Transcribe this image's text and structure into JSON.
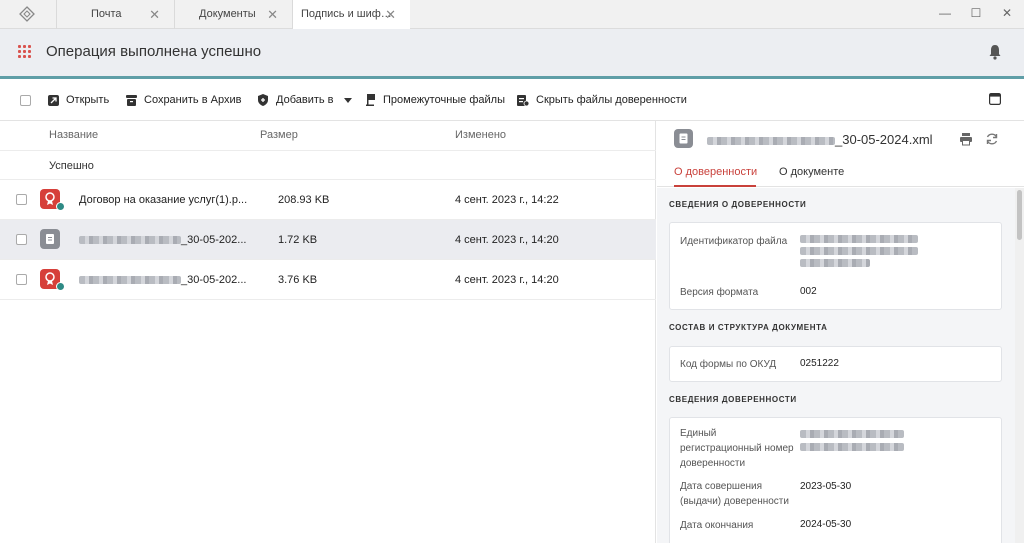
{
  "tabs": [
    {
      "label": "Почта"
    },
    {
      "label": "Документы"
    },
    {
      "label": "Подпись и шиф…",
      "active": true
    }
  ],
  "header": {
    "title": "Операция выполнена успешно"
  },
  "toolbar": {
    "open": "Открыть",
    "save_archive": "Сохранить в Архив",
    "add_to": "Добавить в",
    "intermediate": "Промежуточные файлы",
    "hide_poa": "Скрыть файлы доверенности"
  },
  "list": {
    "columns": {
      "name": "Название",
      "size": "Размер",
      "modified": "Изменено"
    },
    "group": "Успешно",
    "rows": [
      {
        "name": "Договор на оказание услуг(1).p...",
        "size": "208.93 KB",
        "date": "4 сент. 2023 г., 14:22",
        "icon": "certificate-icon",
        "color": "#d6403a"
      },
      {
        "name_suffix": "_30-05-202...",
        "size": "1.72 KB",
        "date": "4 сент. 2023 г., 14:20",
        "icon": "document-icon",
        "color": "#8a8d94"
      },
      {
        "name_suffix": "_30-05-202...",
        "size": "3.76 KB",
        "date": "4 сент. 2023 г., 14:20",
        "icon": "certificate-icon",
        "color": "#d6403a"
      }
    ]
  },
  "panel": {
    "file_suffix": "_30-05-2024.xml",
    "tabs": {
      "poa": "О доверенности",
      "doc": "О документе"
    },
    "sections": {
      "s1": "СВЕДЕНИЯ О ДОВЕРЕННОСТИ",
      "s2": "СОСТАВ И СТРУКТУРА ДОКУМЕНТА",
      "s3": "СВЕДЕНИЯ ДОВЕРЕННОСТИ"
    },
    "fields": {
      "file_id_label": "Идентификатор файла",
      "format_version_label": "Версия формата",
      "format_version": "002",
      "okud_label": "Код формы по ОКУД",
      "okud": "0251222",
      "reg_number_label": "Единый регистрационный номер доверенности",
      "issue_date_label": "Дата совершения (выдачи) доверенности",
      "issue_date": "2023-05-30",
      "end_date_label": "Дата окончания",
      "end_date": "2024-05-30"
    }
  },
  "colors": {
    "accent": "#c9413b",
    "teal": "#5f9ea7"
  }
}
